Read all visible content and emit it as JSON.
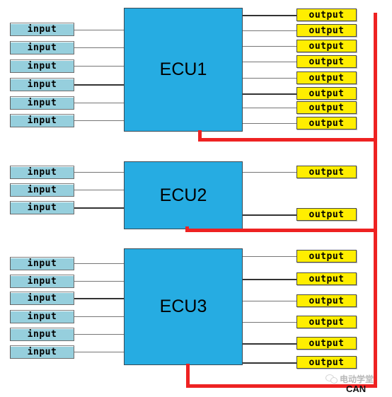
{
  "diagram": {
    "title": "ECU CAN bus input/output diagram",
    "colors": {
      "ecu_fill": "#26ace2",
      "ecu_border": "#3a4a55",
      "input_fill": "#96cfdd",
      "output_fill": "#ffee00",
      "bus": "#ee2222",
      "wire": "#767676",
      "background": "#ffffff"
    },
    "bus": {
      "name": "CAN",
      "label": "CAN"
    },
    "watermark": {
      "text": "电动学堂",
      "icon": "wechat-icon"
    },
    "ecus": [
      {
        "id": "ecu1",
        "label": "ECU1",
        "inputs": [
          {
            "label": "input"
          },
          {
            "label": "input"
          },
          {
            "label": "input"
          },
          {
            "label": "input"
          },
          {
            "label": "input"
          },
          {
            "label": "input"
          }
        ],
        "outputs": [
          {
            "label": "output"
          },
          {
            "label": "output"
          },
          {
            "label": "output"
          },
          {
            "label": "output"
          },
          {
            "label": "output"
          },
          {
            "label": "output"
          },
          {
            "label": "output"
          },
          {
            "label": "output"
          }
        ]
      },
      {
        "id": "ecu2",
        "label": "ECU2",
        "inputs": [
          {
            "label": "input"
          },
          {
            "label": "input"
          },
          {
            "label": "input"
          }
        ],
        "outputs": [
          {
            "label": "output"
          },
          {
            "label": "output"
          }
        ]
      },
      {
        "id": "ecu3",
        "label": "ECU3",
        "inputs": [
          {
            "label": "input"
          },
          {
            "label": "input"
          },
          {
            "label": "input"
          },
          {
            "label": "input"
          },
          {
            "label": "input"
          },
          {
            "label": "input"
          }
        ],
        "outputs": [
          {
            "label": "output"
          },
          {
            "label": "output"
          },
          {
            "label": "output"
          },
          {
            "label": "output"
          },
          {
            "label": "output"
          },
          {
            "label": "output"
          }
        ]
      }
    ]
  }
}
